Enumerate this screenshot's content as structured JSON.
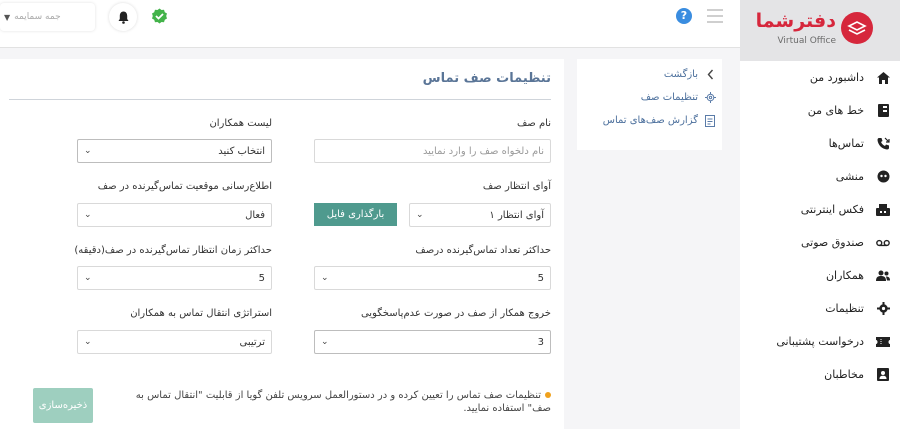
{
  "brand": {
    "name": "دفترشما",
    "tagline": "Virtual Office",
    "color": "#d6273c"
  },
  "topbar": {
    "user_label": "جمه سمایمه",
    "help_glyph": "?"
  },
  "sidebar": {
    "items": [
      {
        "label": "داشبورد من",
        "icon": "home-icon"
      },
      {
        "label": "خط های من",
        "icon": "phone-lines-icon"
      },
      {
        "label": "تماس‌ها",
        "icon": "phone-calls-icon"
      },
      {
        "label": "منشی",
        "icon": "secretary-icon"
      },
      {
        "label": "فکس اینترنتی",
        "icon": "fax-icon"
      },
      {
        "label": "صندوق صوتی",
        "icon": "voicemail-icon"
      },
      {
        "label": "همکاران",
        "icon": "colleagues-icon"
      },
      {
        "label": "تنظیمات",
        "icon": "gear-icon"
      },
      {
        "label": "درخواست پشتیبانی",
        "icon": "ticket-icon"
      },
      {
        "label": "مخاطبان",
        "icon": "contacts-icon"
      }
    ]
  },
  "subnav": {
    "back": "بازگشت",
    "settings": "تنظیمات صف",
    "report": "گزارش صف‌های تماس"
  },
  "form": {
    "title": "تنظیمات صف تماس",
    "queue_name_label": "نام صف",
    "queue_name_placeholder": "نام دلخواه صف را وارد نمایید",
    "colleagues_label": "لیست همکاران",
    "colleagues_value": "انتخاب کنید",
    "music_label": "آوای انتظار صف",
    "music_value": "آوای انتظار ۱",
    "upload_label": "بارگذاری فایل",
    "position_label": "اطلاع‌رسانی موقعیت تماس‌گیرنده در صف",
    "position_value": "فعال",
    "max_callers_label": "حداکثر تعداد تماس‌گیرنده درصف",
    "max_callers_value": "5",
    "max_wait_label": "حداکثر زمان انتظار تماس‌گیرنده در صف(دقیقه)",
    "max_wait_value": "5",
    "exit_label": "خروج همکار از صف در صورت عدم‌پاسخگویی",
    "exit_value": "3",
    "strategy_label": "استراتژی انتقال تماس به همکاران",
    "strategy_value": "ترتیبی",
    "note": "تنظیمات صف تماس را تعیین کرده و در دستورالعمل سرویس تلفن گویا از قابلیت \"انتقال تماس به صف\" استفاده نمایید.",
    "save_label": "ذخیره‌سازی"
  }
}
